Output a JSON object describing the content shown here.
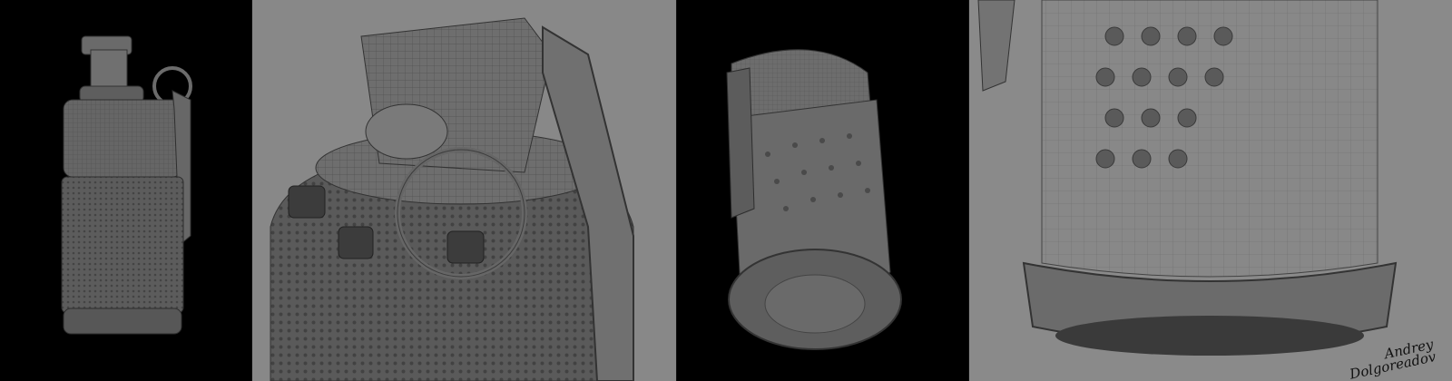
{
  "strip": {
    "panels": [
      {
        "view": "full-view-wireframe"
      },
      {
        "view": "top-closeup-wireframe"
      },
      {
        "view": "bottom-angle-view"
      },
      {
        "view": "base-closeup-wireframe"
      }
    ]
  },
  "signature": {
    "line1": "Andrey",
    "line2": "Dolgoreadov"
  },
  "colors": {
    "black_bg": "#000000",
    "grey_bg": "#888888",
    "mesh_dark": "#3a3a3a",
    "mesh_mid": "#5a5a5a",
    "mesh_light": "#7a7a7a"
  }
}
